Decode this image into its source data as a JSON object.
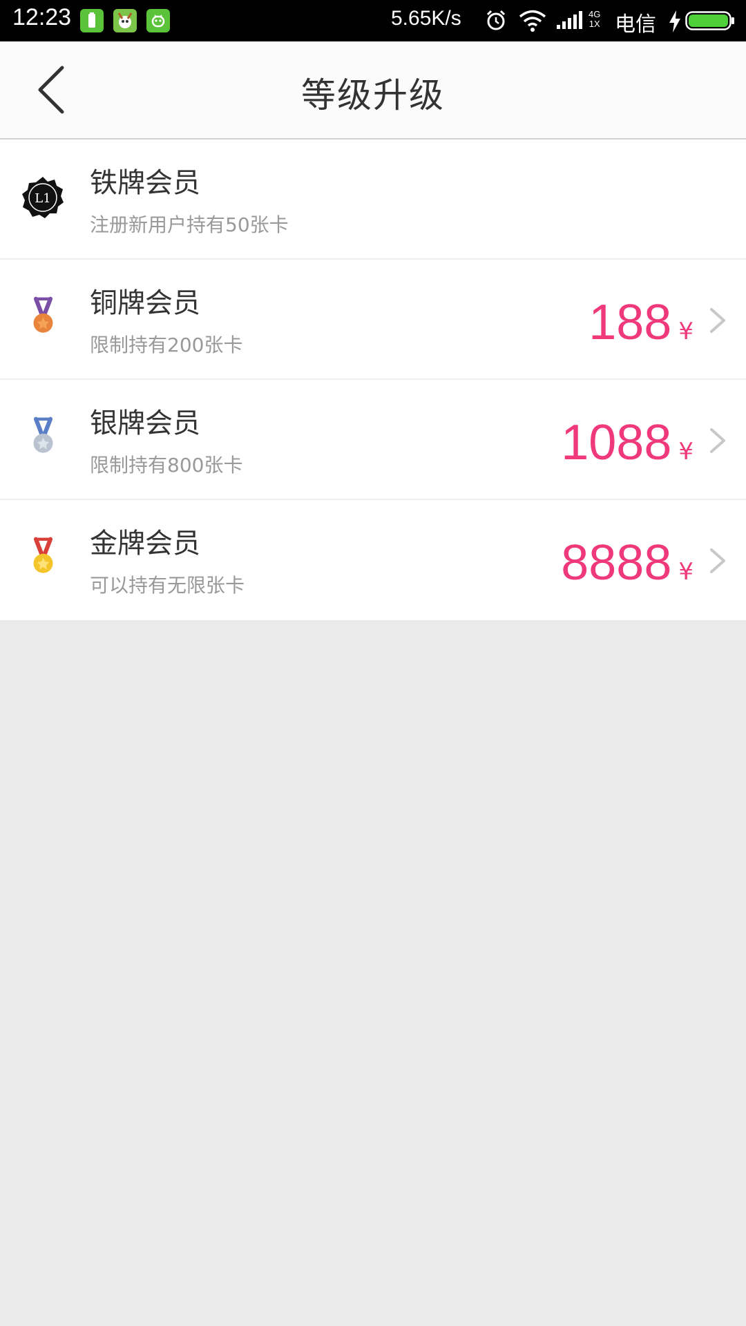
{
  "status_bar": {
    "time": "12:23",
    "speed": "5.65K/s",
    "network_top": "4G",
    "network_bottom": "1X",
    "carrier": "电信"
  },
  "header": {
    "title": "等级升级"
  },
  "tiers": [
    {
      "name": "铁牌会员",
      "desc": "注册新用户持有50张卡",
      "badge_text": "L1"
    },
    {
      "name": "铜牌会员",
      "desc": "限制持有200张卡",
      "price": "188",
      "currency": "¥"
    },
    {
      "name": "银牌会员",
      "desc": "限制持有800张卡",
      "price": "1088",
      "currency": "¥"
    },
    {
      "name": "金牌会员",
      "desc": "可以持有无限张卡",
      "price": "8888",
      "currency": "¥"
    }
  ],
  "colors": {
    "price": "#f0397a",
    "bronze": "#e8843c",
    "silver": "#b9c3cf",
    "gold": "#f4c42b"
  }
}
